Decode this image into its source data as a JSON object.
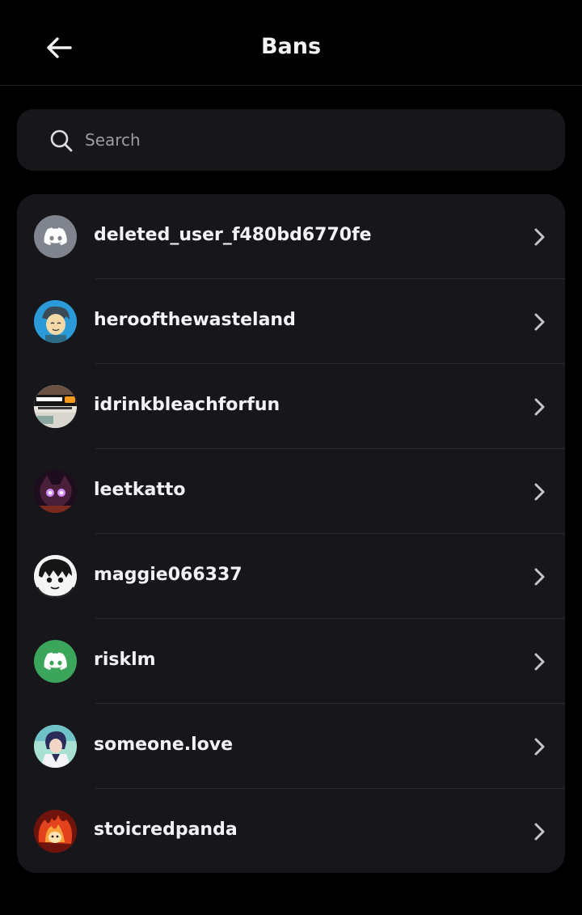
{
  "header": {
    "title": "Bans",
    "back_icon": "arrow-left-icon"
  },
  "search": {
    "placeholder": "Search",
    "value": ""
  },
  "bans": [
    {
      "username": "deleted_user_f480bd6770fe",
      "avatar": "discord-default-gray"
    },
    {
      "username": "heroofthewasteland",
      "avatar": "cartoon-hero"
    },
    {
      "username": "idrinkbleachforfun",
      "avatar": "sandwich-photo"
    },
    {
      "username": "leetkatto",
      "avatar": "purple-glow-creature"
    },
    {
      "username": "maggie066337",
      "avatar": "sketch-face"
    },
    {
      "username": "risklm",
      "avatar": "discord-default-green"
    },
    {
      "username": "someone.love",
      "avatar": "anime-figure"
    },
    {
      "username": "stoicredpanda",
      "avatar": "fiery-panda"
    }
  ],
  "colors": {
    "background": "#000000",
    "surface": "#17171b",
    "text": "#f2f3f5",
    "muted": "#9a9ba3",
    "discord_gray": "#80848e",
    "discord_green": "#3ba55c"
  }
}
